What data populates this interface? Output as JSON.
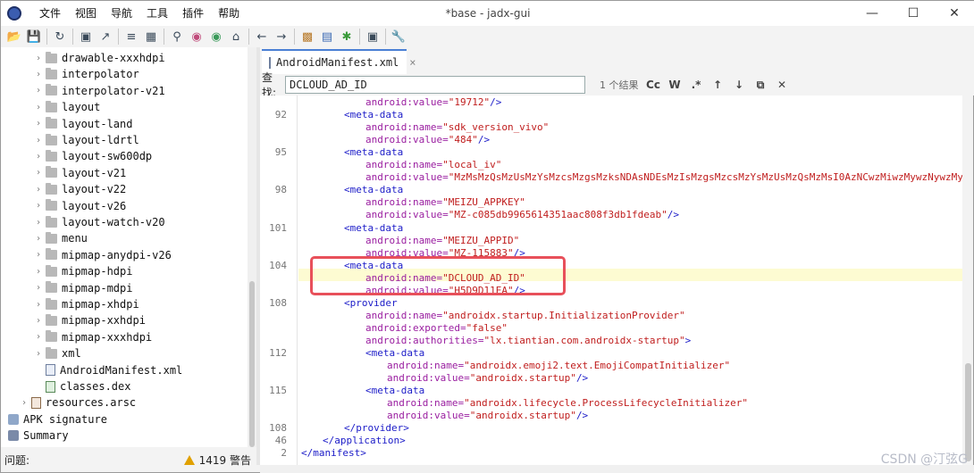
{
  "titlebar": {
    "title": "*base - jadx-gui",
    "menu": [
      "文件",
      "视图",
      "导航",
      "工具",
      "插件",
      "帮助"
    ],
    "minimize": "—",
    "maximize": "☐",
    "close": "✕"
  },
  "toolbar": {
    "buttons": [
      "open-icon",
      "save-all-icon",
      "refresh-icon",
      "save-icon",
      "export-icon",
      "flatten-icon",
      "package-icon",
      "search-icon",
      "find-class-icon",
      "find-usage-icon",
      "home-icon",
      "back-icon",
      "forward-icon",
      "deobf-icon",
      "quark-icon",
      "debug-icon",
      "log-icon",
      "settings-icon"
    ]
  },
  "tree": {
    "items": [
      {
        "label": "drawable-xxxhdpi",
        "type": "folder"
      },
      {
        "label": "interpolator",
        "type": "folder"
      },
      {
        "label": "interpolator-v21",
        "type": "folder"
      },
      {
        "label": "layout",
        "type": "folder"
      },
      {
        "label": "layout-land",
        "type": "folder"
      },
      {
        "label": "layout-ldrtl",
        "type": "folder"
      },
      {
        "label": "layout-sw600dp",
        "type": "folder"
      },
      {
        "label": "layout-v21",
        "type": "folder"
      },
      {
        "label": "layout-v22",
        "type": "folder"
      },
      {
        "label": "layout-v26",
        "type": "folder"
      },
      {
        "label": "layout-watch-v20",
        "type": "folder"
      },
      {
        "label": "menu",
        "type": "folder"
      },
      {
        "label": "mipmap-anydpi-v26",
        "type": "folder"
      },
      {
        "label": "mipmap-hdpi",
        "type": "folder"
      },
      {
        "label": "mipmap-mdpi",
        "type": "folder"
      },
      {
        "label": "mipmap-xhdpi",
        "type": "folder"
      },
      {
        "label": "mipmap-xxhdpi",
        "type": "folder"
      },
      {
        "label": "mipmap-xxxhdpi",
        "type": "folder"
      },
      {
        "label": "xml",
        "type": "folder"
      },
      {
        "label": "AndroidManifest.xml",
        "type": "manifest"
      },
      {
        "label": "classes.dex",
        "type": "dex"
      },
      {
        "label": "resources.arsc",
        "type": "arsc"
      },
      {
        "label": "APK signature",
        "type": "sig"
      },
      {
        "label": "Summary",
        "type": "summary"
      }
    ]
  },
  "editor": {
    "tab_label": "AndroidManifest.xml",
    "tab_close": "×",
    "find_label": "查找:",
    "find_value": "DCLOUD_AD_ID",
    "find_result": "1 个结果",
    "find_buttons": [
      "Cc",
      "W",
      ".*",
      "↑",
      "↓",
      "⧉",
      "✕"
    ],
    "lines": [
      {
        "ln": "",
        "indent": 3,
        "parts": [
          [
            "a",
            "android:value="
          ],
          [
            "v",
            "\"19712\""
          ],
          [
            "t",
            "/>"
          ]
        ]
      },
      {
        "ln": "92",
        "indent": 2,
        "parts": [
          [
            "t",
            "<meta-data"
          ]
        ]
      },
      {
        "ln": "",
        "indent": 3,
        "parts": [
          [
            "a",
            "android:name="
          ],
          [
            "v",
            "\"sdk_version_vivo\""
          ]
        ]
      },
      {
        "ln": "",
        "indent": 3,
        "parts": [
          [
            "a",
            "android:value="
          ],
          [
            "v",
            "\"484\""
          ],
          [
            "t",
            "/>"
          ]
        ]
      },
      {
        "ln": "95",
        "indent": 2,
        "parts": [
          [
            "t",
            "<meta-data"
          ]
        ]
      },
      {
        "ln": "",
        "indent": 3,
        "parts": [
          [
            "a",
            "android:name="
          ],
          [
            "v",
            "\"local_iv\""
          ]
        ]
      },
      {
        "ln": "",
        "indent": 3,
        "parts": [
          [
            "a",
            "android:value="
          ],
          [
            "v",
            "\"MzMsMzQsMzUsMzYsMzcsMzgsMzksNDAsNDEsMzIsMzgsMzcsMzYsMzUsMzQsMzMsI0AzNCwzMiwzMywzNywzMywzNCwzMiw"
          ]
        ]
      },
      {
        "ln": "98",
        "indent": 2,
        "parts": [
          [
            "t",
            "<meta-data"
          ]
        ]
      },
      {
        "ln": "",
        "indent": 3,
        "parts": [
          [
            "a",
            "android:name="
          ],
          [
            "v",
            "\"MEIZU_APPKEY\""
          ]
        ]
      },
      {
        "ln": "",
        "indent": 3,
        "parts": [
          [
            "a",
            "android:value="
          ],
          [
            "v",
            "\"MZ-c085db9965614351aac808f3db1fdeab\""
          ],
          [
            "t",
            "/>"
          ]
        ]
      },
      {
        "ln": "101",
        "indent": 2,
        "parts": [
          [
            "t",
            "<meta-data"
          ]
        ]
      },
      {
        "ln": "",
        "indent": 3,
        "parts": [
          [
            "a",
            "android:name="
          ],
          [
            "v",
            "\"MEIZU_APPID\""
          ]
        ]
      },
      {
        "ln": "",
        "indent": 3,
        "parts": [
          [
            "a",
            "android:value="
          ],
          [
            "v",
            "\"MZ-115883\""
          ],
          [
            "t",
            "/>"
          ]
        ]
      },
      {
        "ln": "104",
        "indent": 2,
        "parts": [
          [
            "t",
            "<meta-data"
          ]
        ]
      },
      {
        "ln": "",
        "indent": 3,
        "parts": [
          [
            "a",
            "android:name="
          ],
          [
            "v",
            "\"DCLOUD_AD_ID\""
          ]
        ]
      },
      {
        "ln": "",
        "indent": 3,
        "parts": [
          [
            "a",
            "android:value="
          ],
          [
            "v",
            "\"H5D9D11EA\""
          ],
          [
            "t",
            "/>"
          ]
        ]
      },
      {
        "ln": "108",
        "indent": 2,
        "parts": [
          [
            "t",
            "<provider"
          ]
        ]
      },
      {
        "ln": "",
        "indent": 3,
        "parts": [
          [
            "a",
            "android:name="
          ],
          [
            "v",
            "\"androidx.startup.InitializationProvider\""
          ]
        ]
      },
      {
        "ln": "",
        "indent": 3,
        "parts": [
          [
            "a",
            "android:exported="
          ],
          [
            "v",
            "\"false\""
          ]
        ]
      },
      {
        "ln": "",
        "indent": 3,
        "parts": [
          [
            "a",
            "android:authorities="
          ],
          [
            "v",
            "\"lx.tiantian.com.androidx-startup\""
          ],
          [
            "t",
            ">"
          ]
        ]
      },
      {
        "ln": "112",
        "indent": 3,
        "parts": [
          [
            "t",
            "<meta-data"
          ]
        ]
      },
      {
        "ln": "",
        "indent": 4,
        "parts": [
          [
            "a",
            "android:name="
          ],
          [
            "v",
            "\"androidx.emoji2.text.EmojiCompatInitializer\""
          ]
        ]
      },
      {
        "ln": "",
        "indent": 4,
        "parts": [
          [
            "a",
            "android:value="
          ],
          [
            "v",
            "\"androidx.startup\""
          ],
          [
            "t",
            "/>"
          ]
        ]
      },
      {
        "ln": "115",
        "indent": 3,
        "parts": [
          [
            "t",
            "<meta-data"
          ]
        ]
      },
      {
        "ln": "",
        "indent": 4,
        "parts": [
          [
            "a",
            "android:name="
          ],
          [
            "v",
            "\"androidx.lifecycle.ProcessLifecycleInitializer\""
          ]
        ]
      },
      {
        "ln": "",
        "indent": 4,
        "parts": [
          [
            "a",
            "android:value="
          ],
          [
            "v",
            "\"androidx.startup\""
          ],
          [
            "t",
            "/>"
          ]
        ]
      },
      {
        "ln": "108",
        "indent": 2,
        "parts": [
          [
            "t",
            "</provider>"
          ]
        ]
      },
      {
        "ln": "46",
        "indent": 1,
        "parts": [
          [
            "t",
            "</application>"
          ]
        ]
      },
      {
        "ln": "2",
        "indent": 0,
        "parts": [
          [
            "t",
            "</manifest>"
          ]
        ]
      }
    ]
  },
  "status": {
    "left": "问题:",
    "warnings": "1419 警告"
  },
  "watermark": "CSDN @汀弦G",
  "colors": {
    "accent": "#4a7fd4",
    "highlight_box": "#e8505a",
    "tag": "#1c1cc8",
    "attr": "#9a1ea0",
    "value": "#c01e1e"
  }
}
